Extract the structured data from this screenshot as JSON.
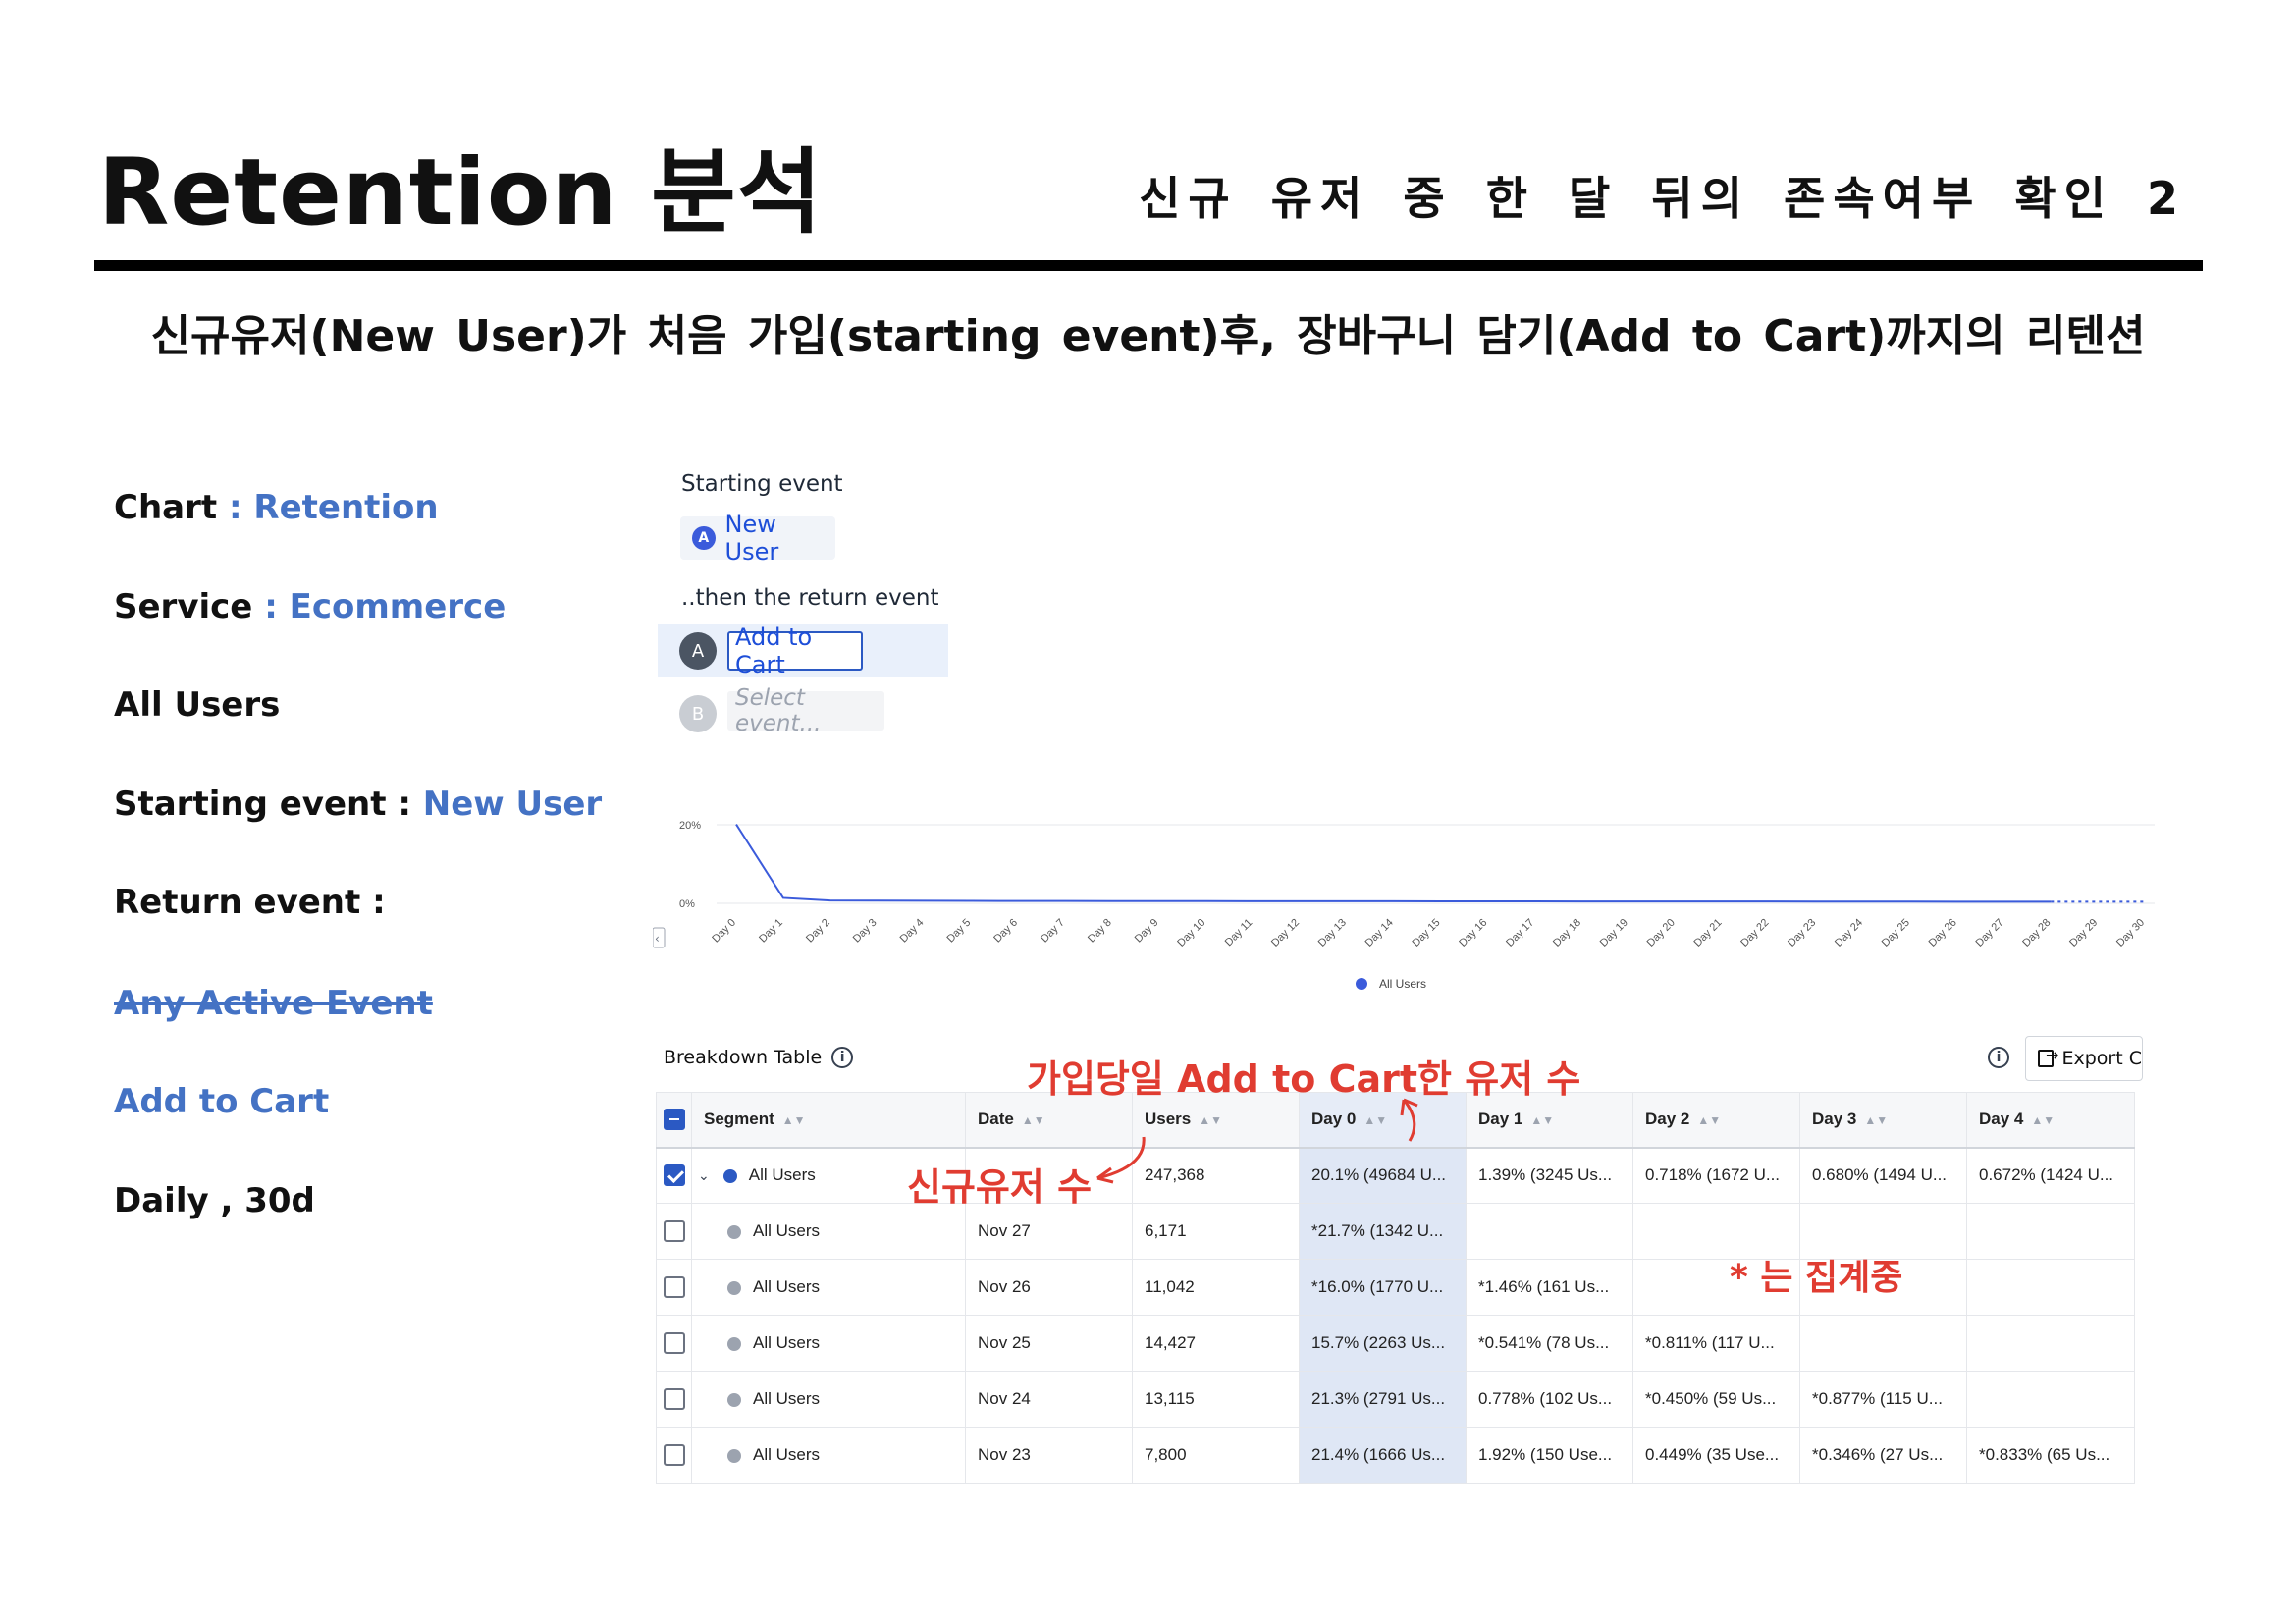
{
  "slide": {
    "title": "Retention  분석",
    "subtitle": "신규 유저 중 한 달 뒤의 존속여부 확인 2",
    "headline": "신규유저(New User)가 처음 가입(starting event)후, 장바구니 담기(Add to Cart)까지의 리텐션"
  },
  "info": {
    "chart_label": "Chart",
    "chart_value": " : Retention",
    "service_label": "Service",
    "service_value": " : Ecommerce",
    "users": "All Users",
    "starting_label": "Starting event : ",
    "starting_value": "New User",
    "return_label": "Return event :",
    "any_active": "Any Active Event",
    "add_to_cart": "Add to Cart",
    "interval": "Daily , 30d"
  },
  "query": {
    "starting_event_label": "Starting event",
    "starting_event_value": "New User",
    "starting_event_badge": "A",
    "return_event_label": "..then the return event",
    "event_a_letter": "A",
    "event_a_value": "Add to Cart",
    "event_b_letter": "B",
    "event_b_placeholder": "Select event..."
  },
  "chart_data": {
    "type": "line",
    "x": [
      "Day 0",
      "Day 1",
      "Day 2",
      "Day 3",
      "Day 4",
      "Day 5",
      "Day 6",
      "Day 7",
      "Day 8",
      "Day 9",
      "Day 10",
      "Day 11",
      "Day 12",
      "Day 13",
      "Day 14",
      "Day 15",
      "Day 16",
      "Day 17",
      "Day 18",
      "Day 19",
      "Day 20",
      "Day 21",
      "Day 22",
      "Day 23",
      "Day 24",
      "Day 25",
      "Day 26",
      "Day 27",
      "Day 28",
      "Day 29",
      "Day 30"
    ],
    "series": [
      {
        "name": "All Users",
        "values": [
          20.1,
          1.39,
          0.72,
          0.68,
          0.67,
          0.62,
          0.6,
          0.58,
          0.57,
          0.55,
          0.55,
          0.54,
          0.53,
          0.52,
          0.52,
          0.5,
          0.5,
          0.49,
          0.48,
          0.48,
          0.47,
          0.46,
          0.46,
          0.45,
          0.45,
          0.44,
          0.42,
          0.4,
          0.4,
          0.4,
          0.4
        ],
        "dotted_from_index": 28
      }
    ],
    "yticks": [
      "20%",
      "0%"
    ],
    "ylim": [
      0,
      20
    ],
    "legend": "bottom-center",
    "grid": true,
    "color": "#3b5bdb"
  },
  "table": {
    "title": "Breakdown Table",
    "export_label": "Export C",
    "columns": [
      "Segment",
      "Date",
      "Users",
      "Day 0",
      "Day 1",
      "Day 2",
      "Day 3",
      "Day 4"
    ],
    "rows": [
      {
        "segment": "All Users",
        "date": "",
        "users": "247,368",
        "day0": "20.1% (49684 U...",
        "day1": "1.39% (3245 Us...",
        "day2": "0.718% (1672 U...",
        "day3": "0.680% (1494 U...",
        "day4": "0.672% (1424 U..."
      },
      {
        "segment": "All Users",
        "date": "Nov 27",
        "users": "6,171",
        "day0": "*21.7% (1342 U...",
        "day1": "",
        "day2": "",
        "day3": "",
        "day4": ""
      },
      {
        "segment": "All Users",
        "date": "Nov 26",
        "users": "11,042",
        "day0": "*16.0% (1770 U...",
        "day1": "*1.46% (161 Us...",
        "day2": "",
        "day3": "",
        "day4": ""
      },
      {
        "segment": "All Users",
        "date": "Nov 25",
        "users": "14,427",
        "day0": "15.7% (2263 Us...",
        "day1": "*0.541% (78 Us...",
        "day2": "*0.811% (117 U...",
        "day3": "",
        "day4": ""
      },
      {
        "segment": "All Users",
        "date": "Nov 24",
        "users": "13,115",
        "day0": "21.3% (2791 Us...",
        "day1": "0.778% (102 Us...",
        "day2": "*0.450% (59 Us...",
        "day3": "*0.877% (115 U...",
        "day4": ""
      },
      {
        "segment": "All Users",
        "date": "Nov 23",
        "users": "7,800",
        "day0": "21.4% (1666 Us...",
        "day1": "1.92% (150 Use...",
        "day2": "0.449% (35 Use...",
        "day3": "*0.346% (27 Us...",
        "day4": "*0.833% (65 Us..."
      }
    ]
  },
  "annotations": {
    "day0_note": "가입당일 Add to Cart한 유저 수",
    "users_note": "신규유저 수",
    "asterisk_note": "* 는 집계중",
    "color": "#e03c31"
  }
}
